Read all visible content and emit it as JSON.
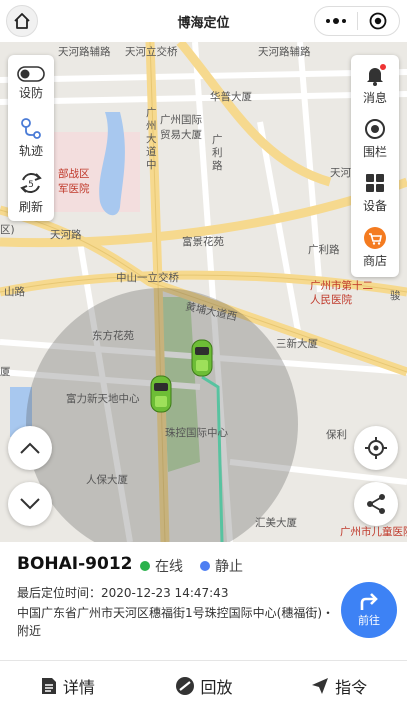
{
  "app": {
    "title": "博海定位"
  },
  "map": {
    "labels": [
      {
        "text": "天河立交桥"
      },
      {
        "text": "天河路辅路"
      },
      {
        "text": "天河路辅路"
      },
      {
        "text": "华普大厦"
      },
      {
        "text": "广州国际"
      },
      {
        "text": "贸易大厦"
      },
      {
        "text": "广州大道中"
      },
      {
        "text": "广利路"
      },
      {
        "text": "部战区"
      },
      {
        "text": "军医院"
      },
      {
        "text": "区)"
      },
      {
        "text": "天河"
      },
      {
        "text": "天河路"
      },
      {
        "text": "富景花苑"
      },
      {
        "text": "广利路"
      },
      {
        "text": "中山一立交桥"
      },
      {
        "text": "广州市第十二"
      },
      {
        "text": "人民医院"
      },
      {
        "text": "骏"
      },
      {
        "text": "山路"
      },
      {
        "text": "东方花苑"
      },
      {
        "text": "黄埔大道西"
      },
      {
        "text": "三新大厦"
      },
      {
        "text": "富力新天地中心"
      },
      {
        "text": "厦"
      },
      {
        "text": "珠控国际中心"
      },
      {
        "text": "保利"
      },
      {
        "text": "人保大厦"
      },
      {
        "text": "汇美大厦"
      },
      {
        "text": "广州市儿童医院"
      }
    ]
  },
  "left_panel": [
    {
      "label": "设防"
    },
    {
      "label": "轨迹"
    },
    {
      "label": "刷新"
    }
  ],
  "right_panel": [
    {
      "label": "消息"
    },
    {
      "label": "围栏"
    },
    {
      "label": "设备"
    },
    {
      "label": "商店"
    }
  ],
  "device": {
    "name": "BOHAI-9012",
    "online_status": "在线",
    "motion_status": "静止",
    "online_color": "#2bb24c",
    "motion_color": "#4e7ef2",
    "time_label": "最后定位时间：2020-12-23 14:47:43",
    "address": "中国广东省广州市天河区穗福街1号珠控国际中心(穗福街)・附近",
    "go_label": "前往"
  },
  "bottom_nav": [
    {
      "label": "详情"
    },
    {
      "label": "回放"
    },
    {
      "label": "指令"
    }
  ],
  "colors": {
    "accent": "#3d82f5",
    "notify_dot": "#e33",
    "shop_icon": "#f47b20",
    "car": "#7ac943"
  }
}
